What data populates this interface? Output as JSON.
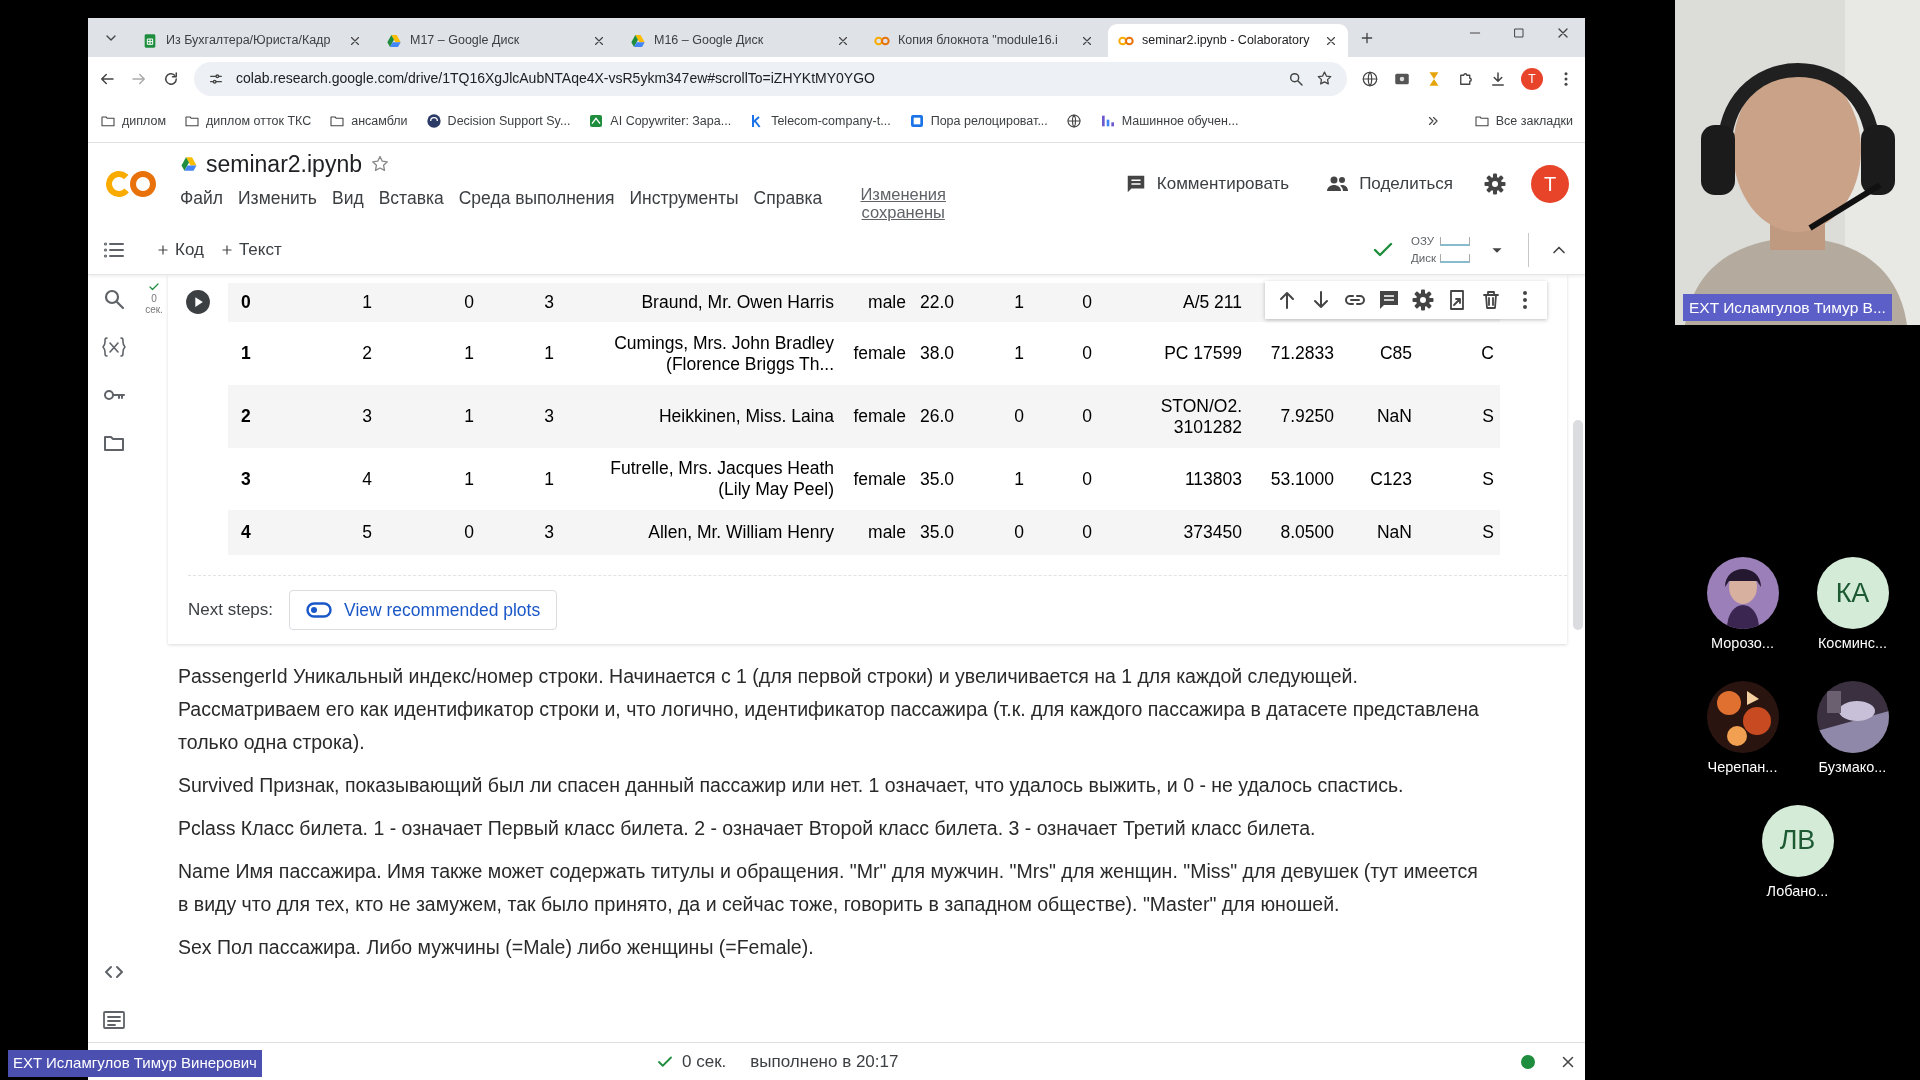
{
  "browser": {
    "tabs": [
      {
        "title": "Из Бухгалтера/Юриста/Кадр",
        "kind": "sheets",
        "selected": false
      },
      {
        "title": "M17 – Google Диск",
        "kind": "drive",
        "selected": false
      },
      {
        "title": "M16 – Google Диск",
        "kind": "drive",
        "selected": false
      },
      {
        "title": "Копия блокнота \"module16.i",
        "kind": "colab",
        "selected": false
      },
      {
        "title": "seminar2.ipynb - Colaboratory",
        "kind": "colab",
        "selected": true
      }
    ],
    "address": "colab.research.google.com/drive/1TQ16XgJlcAubNTAqe4X-vsR5ykm347ew#scrollTo=iZHYKtMY0YGO",
    "profile_initial": "T",
    "bookmarks": [
      {
        "label": "диплом",
        "kind": "folder"
      },
      {
        "label": "диплом отток ТКС",
        "kind": "folder"
      },
      {
        "label": "ансамбли",
        "kind": "folder"
      },
      {
        "label": "Decision Support Sy...",
        "kind": "round"
      },
      {
        "label": "AI Copywriter: Зара...",
        "kind": "square"
      },
      {
        "label": "Telecom-company-t...",
        "kind": "mark"
      },
      {
        "label": "Пора релоцироват...",
        "kind": "square"
      },
      {
        "kind": "globe"
      },
      {
        "label": "Машинное обучен...",
        "kind": "bars"
      }
    ],
    "all_bookmarks": "Все закладки"
  },
  "notebook": {
    "title": "seminar2.ipynb",
    "menu": [
      "Файл",
      "Изменить",
      "Вид",
      "Вставка",
      "Среда выполнения",
      "Инструменты",
      "Справка"
    ],
    "save_status": "Изменения сохранены",
    "comment": "Комментировать",
    "share": "Поделиться",
    "avatar": "T",
    "toolbar": {
      "add_code": "Код",
      "add_text": "Текст",
      "ram": "ОЗУ",
      "disk": "Диск"
    }
  },
  "output_cell": {
    "exec_count": "0",
    "exec_unit": "сек.",
    "rows": [
      [
        "0",
        "1",
        "0",
        "3",
        "Braund, Mr. Owen Harris",
        "male",
        "22.0",
        "1",
        "0",
        "A/5 211"
      ],
      [
        "1",
        "2",
        "1",
        "1",
        "Cumings, Mrs. John Bradley (Florence Briggs Th...",
        "female",
        "38.0",
        "1",
        "0",
        "PC 17599",
        "71.2833",
        "C85",
        "C"
      ],
      [
        "2",
        "3",
        "1",
        "3",
        "Heikkinen, Miss. Laina",
        "female",
        "26.0",
        "0",
        "0",
        "STON/O2. 3101282",
        "7.9250",
        "NaN",
        "S"
      ],
      [
        "3",
        "4",
        "1",
        "1",
        "Futrelle, Mrs. Jacques Heath (Lily May Peel)",
        "female",
        "35.0",
        "1",
        "0",
        "113803",
        "53.1000",
        "C123",
        "S"
      ],
      [
        "4",
        "5",
        "0",
        "3",
        "Allen, Mr. William Henry",
        "male",
        "35.0",
        "0",
        "0",
        "373450",
        "8.0500",
        "NaN",
        "S"
      ]
    ],
    "next_steps_label": "Next steps:",
    "next_steps_button": "View recommended plots"
  },
  "text_cell": {
    "paragraphs": [
      "PassengerId Уникальный индекс/номер строки. Начинается с 1 (для первой строки) и увеличивается на 1 для каждой следующей. Рассматриваем его как идентификатор строки и, что логично, идентификатор пассажира (т.к. для каждого пассажира в датасете представлена только одна строка).",
      "Survived Признак, показывающий был ли спасен данный пассажир или нет. 1 означает, что удалось выжить, и 0 - не удалось спастись.",
      "Pclass Класс билета. 1 - означает Первый класс билета. 2 - означает Второй класс билета. 3 - означает Третий класс билета.",
      "Name Имя пассажира. Имя также может содержать титулы и обращения. \"Mr\" для мужчин. \"Mrs\" для женщин. \"Miss\" для девушек (тут имеется в виду что для тех, кто не замужем, так было принято, да и сейчас тоже, говорить в западном обществе). \"Master\" для юношей.",
      "Sex Пол пассажира. Либо мужчины (=Male) либо женщины (=Female)."
    ]
  },
  "status_bar": {
    "duration": "0 сек.",
    "executed": "выполнено в 20:17"
  },
  "call": {
    "speaker": "EXT Исламгулов Тимур В...",
    "participants": [
      {
        "name": "Морозо...",
        "kind": "picture"
      },
      {
        "name": "Косминс...",
        "kind": "initials",
        "initials": "КА"
      },
      {
        "name": "Черепан...",
        "kind": "picture"
      },
      {
        "name": "Бузмако...",
        "kind": "picture"
      },
      {
        "name": "Лобано...",
        "kind": "initials",
        "initials": "ЛВ"
      }
    ],
    "presenter": "EXT Исламгулов Тимур Винерович"
  }
}
